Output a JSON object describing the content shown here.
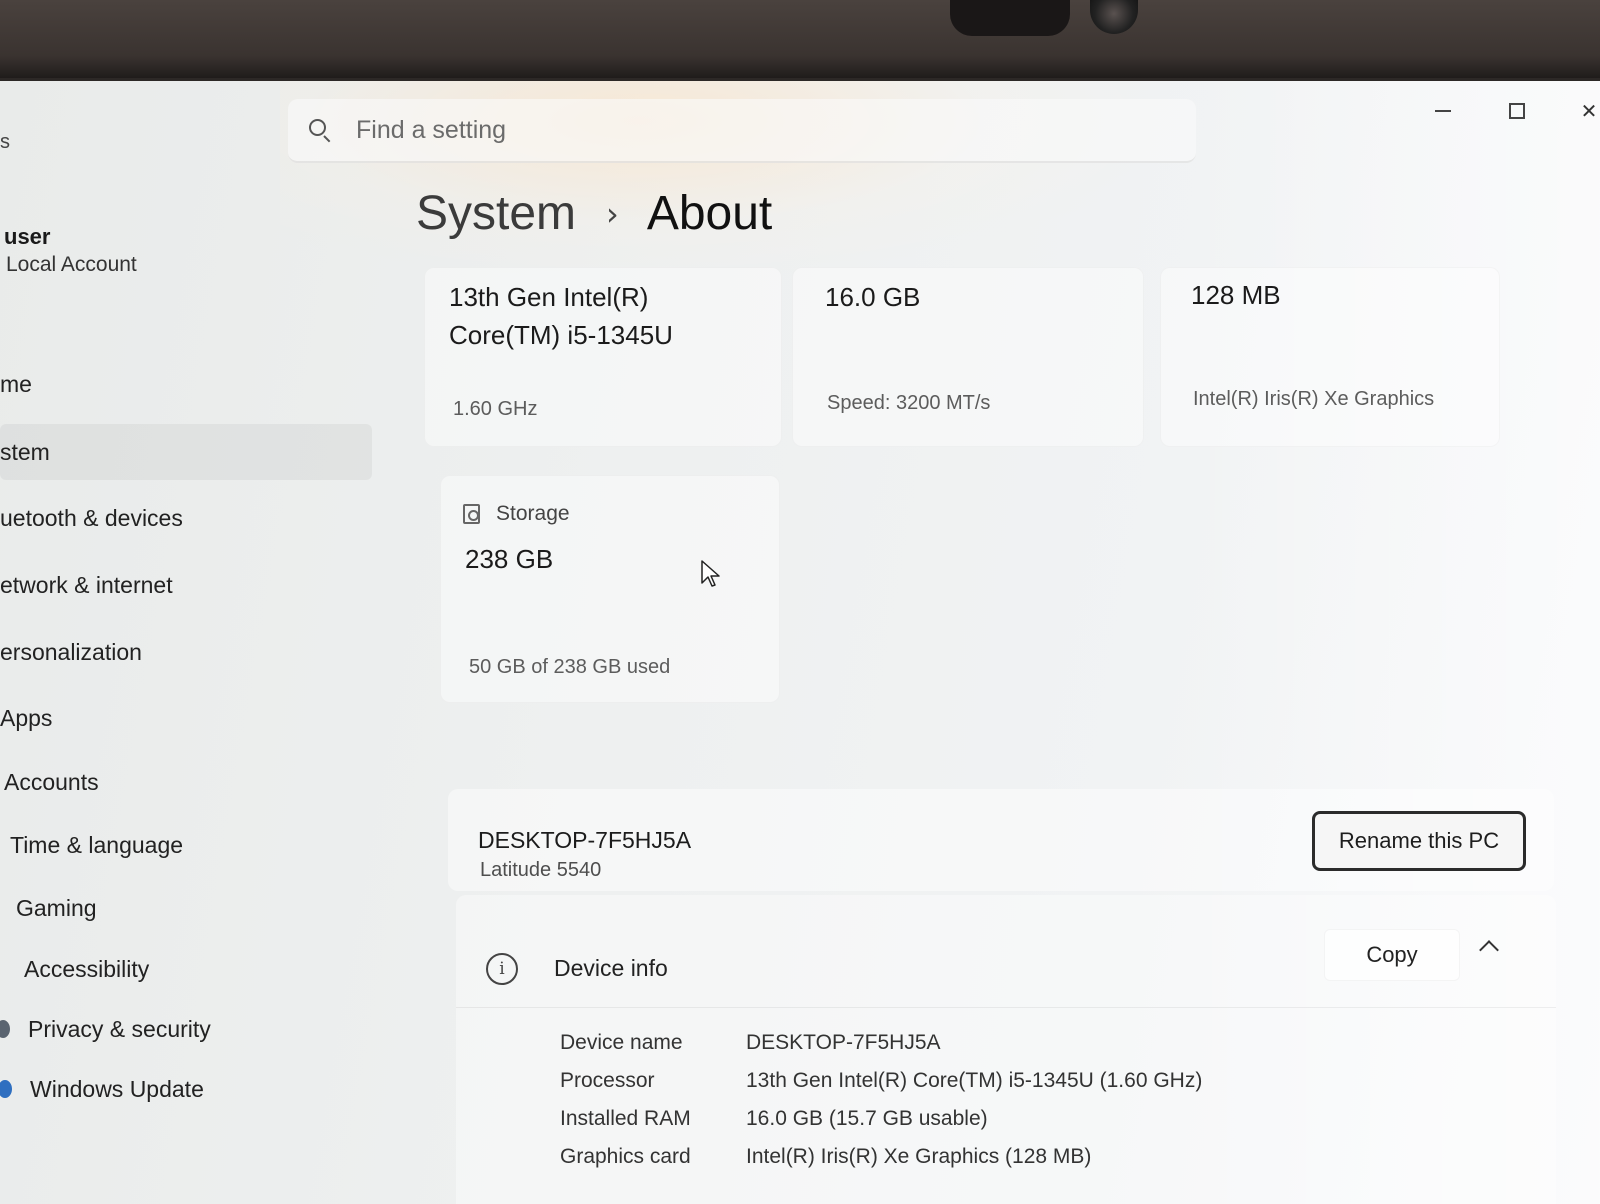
{
  "app": {
    "title_fragment": "s"
  },
  "search": {
    "placeholder": "Find a setting"
  },
  "user": {
    "name": "user",
    "account_type": "Local Account"
  },
  "sidebar": {
    "items": [
      {
        "label": "me",
        "active": false
      },
      {
        "label": "stem",
        "active": true
      },
      {
        "label": "uetooth & devices",
        "active": false
      },
      {
        "label": "etwork & internet",
        "active": false
      },
      {
        "label": "ersonalization",
        "active": false
      },
      {
        "label": "Apps",
        "active": false
      },
      {
        "label": "Accounts",
        "active": false
      },
      {
        "label": "Time & language",
        "active": false
      },
      {
        "label": "Gaming",
        "active": false
      },
      {
        "label": "Accessibility",
        "active": false
      },
      {
        "label": "Privacy & security",
        "active": false
      },
      {
        "label": "Windows Update",
        "active": false
      }
    ]
  },
  "breadcrumb": {
    "parent": "System",
    "separator": "›",
    "current": "About"
  },
  "specs": {
    "processor": {
      "value": "13th Gen Intel(R) Core(TM) i5-1345U",
      "sub": "1.60 GHz"
    },
    "memory": {
      "value": "16.0 GB",
      "sub": "Speed: 3200 MT/s"
    },
    "graphics": {
      "value": "128 MB",
      "sub": "Intel(R) Iris(R) Xe Graphics"
    },
    "storage": {
      "title": "Storage",
      "value": "238 GB",
      "sub": "50 GB of 238 GB used"
    }
  },
  "pc": {
    "name": "DESKTOP-7F5HJ5A",
    "model": "Latitude 5540",
    "rename_label": "Rename this PC"
  },
  "device_info": {
    "title": "Device info",
    "copy_label": "Copy",
    "rows": [
      {
        "label": "Device name",
        "value": "DESKTOP-7F5HJ5A"
      },
      {
        "label": "Processor",
        "value": "13th Gen Intel(R) Core(TM) i5-1345U (1.60 GHz)"
      },
      {
        "label": "Installed RAM",
        "value": "16.0 GB (15.7 GB usable)"
      },
      {
        "label": "Graphics card",
        "value": "Intel(R) Iris(R) Xe Graphics (128 MB)"
      }
    ]
  },
  "colors": {
    "accent": "#0067c0",
    "background": "#eef0f0"
  }
}
